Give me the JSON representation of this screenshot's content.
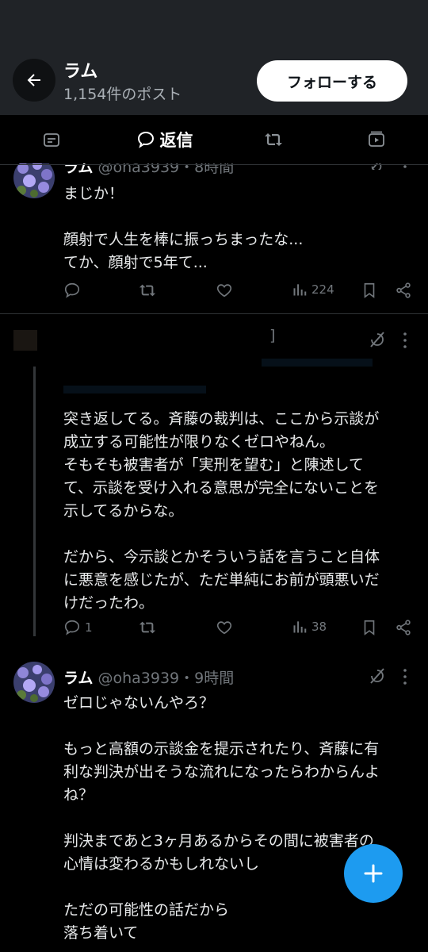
{
  "header": {
    "name": "ラム",
    "post_count": "1,154件のポスト",
    "follow_label": "フォローする"
  },
  "tabs": {
    "active_label": "返信"
  },
  "posts": [
    {
      "name": "ラム",
      "handle": "@oha3939",
      "time": "・8時間",
      "body": "まじか！\n\n顔射で人生を棒に振っちまったな...\nてか、顔射で5年て...",
      "replies": "",
      "views": "224"
    },
    {
      "name": "",
      "handle": "",
      "time": "",
      "partial_fragment": "]",
      "body": "突き返してる。斉藤の裁判は、ここから示談が\n成立する可能性が限りなくゼロやねん。\nそもそも被害者が「実刑を望む」と陳述して\nて、示談を受け入れる意思が完全にないことを\n示してるからな。\n\nだから、今示談とかそういう話を言うこと自体\nに悪意を感じたが、ただ単純にお前が頭悪いだ\nけだったわ。",
      "replies": "1",
      "views": "38"
    },
    {
      "name": "ラム",
      "handle": "@oha3939",
      "time": "・9時間",
      "body": "ゼロじゃないんやろ？\n\nもっと高額の示談金を提示されたり、斉藤に有\n利な判決が出そうな流れになったらわからんよ\nね？\n\n判決まであと3ヶ月あるからその間に被害者の\n心情は変わるかもしれないし\n\nただの可能性の話だから\n落ち着いて"
    }
  ],
  "colors": {
    "accent": "#1d9bf0",
    "header_bg": "#202327",
    "muted": "#71767b"
  }
}
